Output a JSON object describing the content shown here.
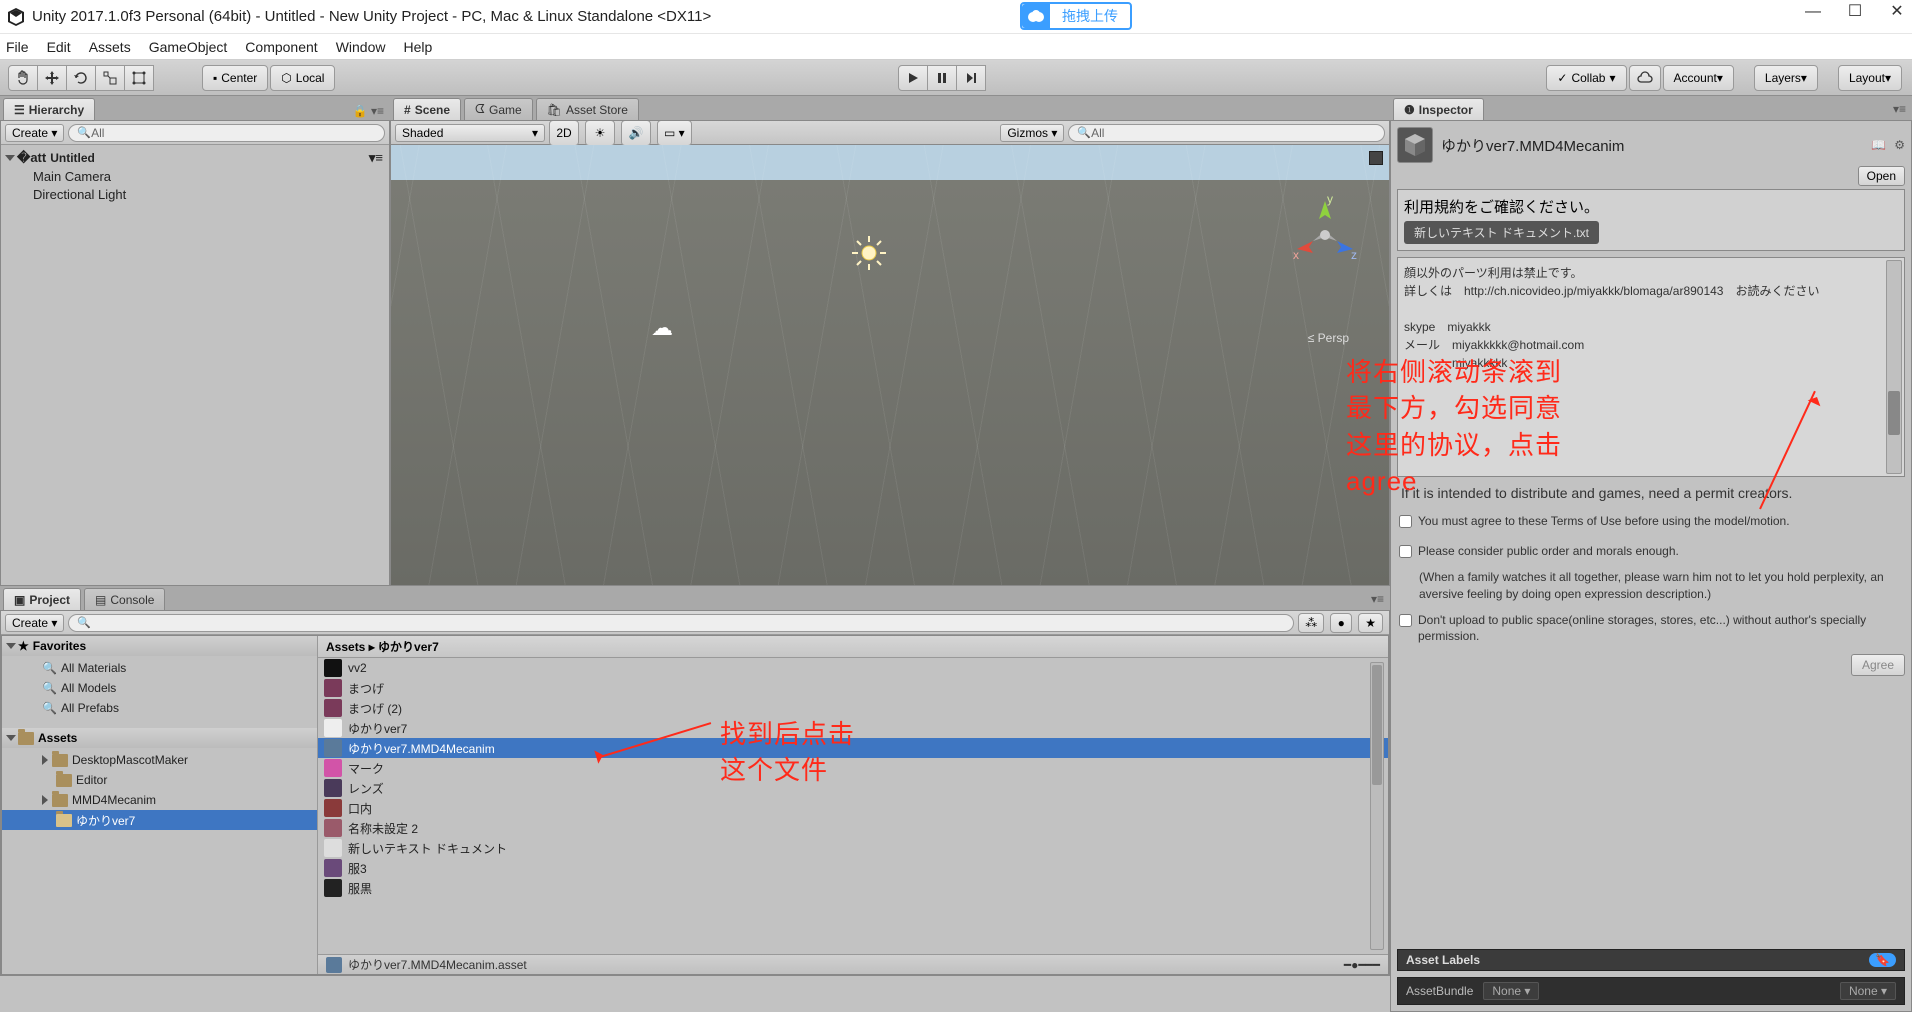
{
  "window": {
    "title": "Unity 2017.1.0f3 Personal (64bit) - Untitled - New Unity Project - PC, Mac & Linux Standalone <DX11>",
    "upload": "拖拽上传"
  },
  "menu": [
    "File",
    "Edit",
    "Assets",
    "GameObject",
    "Component",
    "Window",
    "Help"
  ],
  "toolbar": {
    "center": "Center",
    "local": "Local",
    "collab": "Collab",
    "account": "Account",
    "layers": "Layers",
    "layout": "Layout"
  },
  "hierarchy": {
    "tab": "Hierarchy",
    "create": "Create",
    "search": "All",
    "root": "Untitled",
    "children": [
      "Main Camera",
      "Directional Light"
    ]
  },
  "scene": {
    "tabs": [
      "Scene",
      "Game",
      "Asset Store"
    ],
    "shaded": "Shaded",
    "twod": "2D",
    "gizmos": "Gizmos",
    "search": "All",
    "persp": "Persp"
  },
  "project": {
    "tab": "Project",
    "console": "Console",
    "create": "Create",
    "favorites": "Favorites",
    "fav_items": [
      "All Materials",
      "All Models",
      "All Prefabs"
    ],
    "assets": "Assets",
    "folders": [
      "DesktopMascotMaker",
      "Editor",
      "MMD4Mecanim",
      "ゆかりver7"
    ],
    "breadcrumb": "Assets ▸ ゆかりver7",
    "files": [
      "vv2",
      "まつげ",
      "まつげ (2)",
      "ゆかりver7",
      "ゆかりver7.MMD4Mecanim",
      "マーク",
      "レンズ",
      "口内",
      "名称未設定 2",
      "新しいテキスト ドキュメント",
      "服3",
      "服黒"
    ],
    "selected": 4,
    "status": "ゆかりver7.MMD4Mecanim.asset"
  },
  "inspector": {
    "tab": "Inspector",
    "name": "ゆかりver7.MMD4Mecanim",
    "open": "Open",
    "terms_head": "利用規約をご確認ください。",
    "terms_doc": "新しいテキスト ドキュメント.txt",
    "terms_body": "顔以外のパーツ利用は禁止です。\n詳しくは　http://ch.nicovideo.jp/miyakkk/blomaga/ar890143　お読みください\n\nskype　miyakkk\nメール　miyakkkkk@hotmail.com\n　　　　miyakkkkk",
    "intro": "If it is intended to distribute and games, need a permit creators.",
    "chk1": "You must agree to these Terms of Use before using the model/motion.",
    "chk2": "Please consider public order and morals enough.",
    "chk2note": "(When a family watches it all together, please warn him not to let you hold perplexity, an aversive feeling by doing open expression description.)",
    "chk3": "Don't upload to public space(online storages, stores, etc...) without author's specially permission.",
    "agree": "Agree",
    "labels": "Asset Labels",
    "bundle": "AssetBundle",
    "none": "None"
  },
  "annot": {
    "a1": "找到后点击\n这个文件",
    "a2": "将右侧滚动条滚到\n最下方，勾选同意\n这里的协议，点击\nagree"
  }
}
